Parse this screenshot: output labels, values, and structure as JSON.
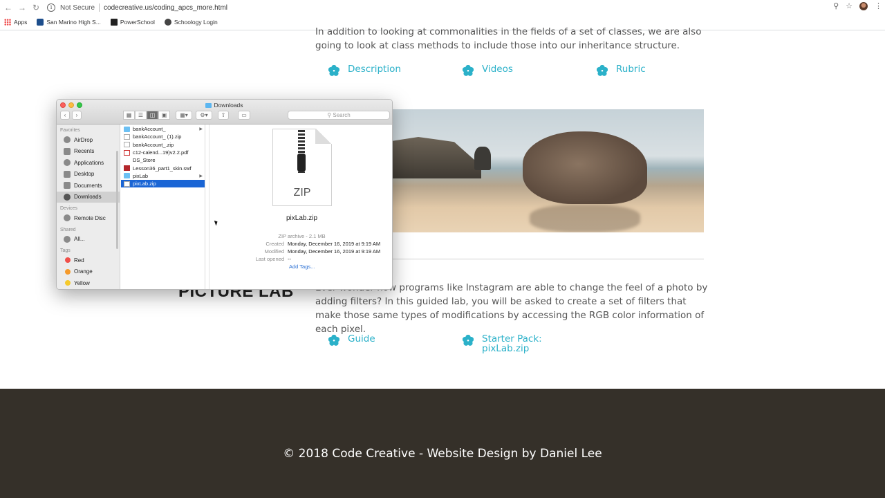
{
  "browser": {
    "not_secure": "Not Secure",
    "url": "codecreative.us/coding_apcs_more.html",
    "bookmarks": [
      {
        "label": "Apps"
      },
      {
        "label": "San Marino High S..."
      },
      {
        "label": "PowerSchool"
      },
      {
        "label": "Schoology Login"
      }
    ]
  },
  "page": {
    "intro": "In addition to looking at commonalities in the fields of a set of classes, we are also going to look at class methods to include those into our inheritance structure.",
    "links1": [
      "Description",
      "Videos",
      "Rubric"
    ],
    "section_title": "PICTURE LAB",
    "body": "Ever wonder how programs like Instagram are able to change the feel of a photo by adding filters? In this guided lab, you will be asked to create a set of filters that make those same types of modifications by accessing the RGB color information of each pixel.",
    "links2": {
      "guide": "Guide",
      "starter_line1": "Starter Pack:",
      "starter_line2": "pixLab.zip"
    },
    "footer": "© 2018 Code Creative - Website Design by Daniel Lee",
    "accent": "#2bb1c9",
    "footer_bg": "#353029"
  },
  "finder": {
    "title": "Downloads",
    "search_placeholder": "Search",
    "sidebar": {
      "favorites_label": "Favorites",
      "favorites": [
        "AirDrop",
        "Recents",
        "Applications",
        "Desktop",
        "Documents",
        "Downloads"
      ],
      "devices_label": "Devices",
      "devices": [
        "Remote Disc"
      ],
      "shared_label": "Shared",
      "shared": [
        "All..."
      ],
      "tags_label": "Tags",
      "tags": [
        {
          "label": "Red",
          "color": "#f0504a"
        },
        {
          "label": "Orange",
          "color": "#f59a2b"
        },
        {
          "label": "Yellow",
          "color": "#f5c92b"
        }
      ]
    },
    "files": [
      {
        "name": "bankAccount_",
        "kind": "folder"
      },
      {
        "name": "bankAccount_ (1).zip",
        "kind": "zip"
      },
      {
        "name": "bankAccount_.zip",
        "kind": "zip"
      },
      {
        "name": "c12-calend...19)v2.2.pdf",
        "kind": "pdf"
      },
      {
        "name": "DS_Store",
        "kind": "blank"
      },
      {
        "name": "Lesson36_part1_skin.swf",
        "kind": "swf"
      },
      {
        "name": "pixLab",
        "kind": "folder"
      },
      {
        "name": "pixLab.zip",
        "kind": "zip"
      }
    ],
    "preview": {
      "icon_label": "ZIP",
      "name": "pixLab.zip",
      "kind": "ZIP archive - 2.1 MB",
      "created_label": "Created",
      "created": "Monday, December 16, 2019 at 9:19 AM",
      "modified_label": "Modified",
      "modified": "Monday, December 16, 2019 at 9:19 AM",
      "last_opened_label": "Last opened",
      "last_opened": "--",
      "add_tags": "Add Tags..."
    }
  }
}
